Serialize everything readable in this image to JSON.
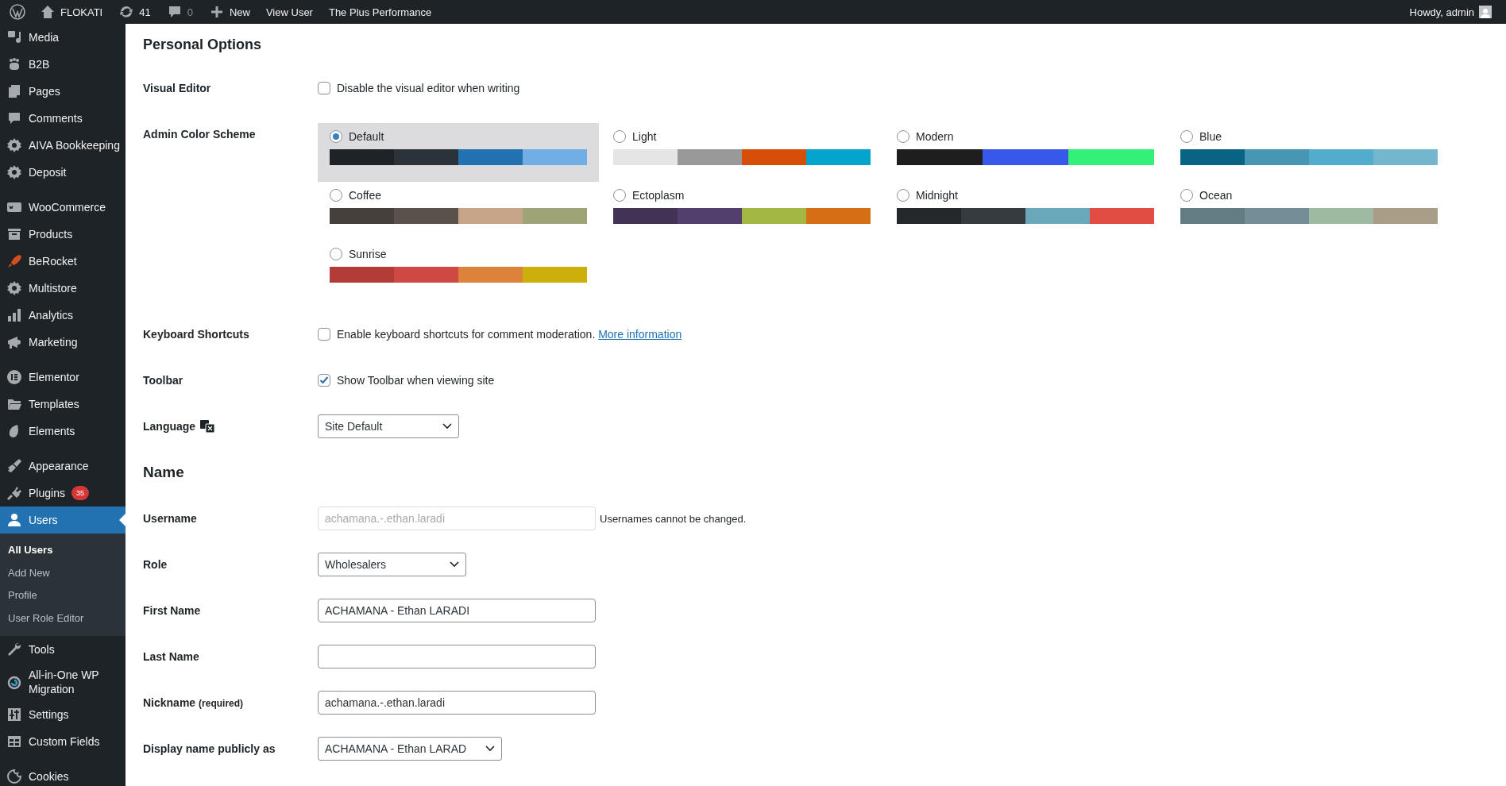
{
  "admin_bar": {
    "site_name": "FLOKATI",
    "updates_count": "41",
    "comments_count": "0",
    "new_label": "New",
    "links": [
      "View User",
      "The Plus Performance"
    ],
    "greeting": "Howdy, admin"
  },
  "sidebar": {
    "groups": [
      [
        {
          "label": "Media",
          "selected": false
        },
        {
          "label": "B2B",
          "selected": false
        },
        {
          "label": "Pages",
          "selected": false
        },
        {
          "label": "Comments",
          "selected": false
        },
        {
          "label": "AIVA Bookkeeping",
          "selected": false
        },
        {
          "label": "Deposit",
          "selected": false
        }
      ],
      [
        {
          "label": "WooCommerce",
          "selected": false
        },
        {
          "label": "Products",
          "selected": false
        },
        {
          "label": "BeRocket",
          "selected": false
        },
        {
          "label": "Multistore",
          "selected": false
        },
        {
          "label": "Analytics",
          "selected": false
        },
        {
          "label": "Marketing",
          "selected": false
        }
      ],
      [
        {
          "label": "Elementor",
          "selected": false
        },
        {
          "label": "Templates",
          "selected": false
        },
        {
          "label": "Elements",
          "selected": false
        }
      ],
      [
        {
          "label": "Appearance",
          "selected": false
        },
        {
          "label": "Plugins",
          "selected": false,
          "badge": "35"
        },
        {
          "label": "Users",
          "selected": true,
          "submenu": [
            {
              "label": "All Users",
              "selected": true
            },
            {
              "label": "Add New",
              "selected": false
            },
            {
              "label": "Profile",
              "selected": false
            },
            {
              "label": "User Role Editor",
              "selected": false
            }
          ]
        },
        {
          "label": "Tools",
          "selected": false
        },
        {
          "label": "All-in-One WP Migration",
          "selected": false
        },
        {
          "label": "Settings",
          "selected": false
        },
        {
          "label": "Custom Fields",
          "selected": false
        }
      ],
      [
        {
          "label": "Cookies",
          "selected": false
        }
      ]
    ]
  },
  "personal_options": {
    "heading": "Personal Options",
    "visual_editor": {
      "label": "Visual Editor",
      "checkbox_label": "Disable the visual editor when writing",
      "checked": false
    },
    "color_scheme": {
      "label": "Admin Color Scheme",
      "schemes": [
        {
          "name": "Default",
          "selected": true,
          "swatches": [
            {
              "color": "#1d2327"
            },
            {
              "color": "#2c3338"
            },
            {
              "color": "#2271b1"
            },
            {
              "color": "#72aee6"
            }
          ]
        },
        {
          "name": "Light",
          "selected": false,
          "swatches": [
            {
              "color": "#e5e5e5"
            },
            {
              "color": "#999999"
            },
            {
              "color": "#d64e07"
            },
            {
              "color": "#04a4cc"
            }
          ]
        },
        {
          "name": "Modern",
          "selected": false,
          "swatches": [
            {
              "color": "#1e1e1e"
            },
            {
              "color": "#3858e9"
            },
            {
              "color": "#33f078"
            }
          ]
        },
        {
          "name": "Blue",
          "selected": false,
          "swatches": [
            {
              "color": "#096484"
            },
            {
              "color": "#4796b3"
            },
            {
              "color": "#52accc"
            },
            {
              "color": "#74b6ce"
            }
          ]
        },
        {
          "name": "Coffee",
          "selected": false,
          "swatches": [
            {
              "color": "#46403c"
            },
            {
              "color": "#59524c"
            },
            {
              "color": "#c7a589"
            },
            {
              "color": "#9ea476"
            }
          ]
        },
        {
          "name": "Ectoplasm",
          "selected": false,
          "swatches": [
            {
              "color": "#413256"
            },
            {
              "color": "#523f6d"
            },
            {
              "color": "#a3b745"
            },
            {
              "color": "#d46f15"
            }
          ]
        },
        {
          "name": "Midnight",
          "selected": false,
          "swatches": [
            {
              "color": "#25282b"
            },
            {
              "color": "#363b3f"
            },
            {
              "color": "#69a8bb"
            },
            {
              "color": "#e14d43"
            }
          ]
        },
        {
          "name": "Ocean",
          "selected": false,
          "swatches": [
            {
              "color": "#627c83"
            },
            {
              "color": "#738e96"
            },
            {
              "color": "#9ebaa0"
            },
            {
              "color": "#aa9d88"
            }
          ]
        },
        {
          "name": "Sunrise",
          "selected": false,
          "swatches": [
            {
              "color": "#b43c38"
            },
            {
              "color": "#cf4944"
            },
            {
              "color": "#dd823b"
            },
            {
              "color": "#ccaf0b"
            }
          ]
        }
      ]
    },
    "keyboard_shortcuts": {
      "label": "Keyboard Shortcuts",
      "checkbox_label": "Enable keyboard shortcuts for comment moderation.",
      "link": "More information",
      "checked": false
    },
    "toolbar": {
      "label": "Toolbar",
      "checkbox_label": "Show Toolbar when viewing site",
      "checked": true
    },
    "language": {
      "label": "Language",
      "value": "Site Default"
    }
  },
  "name_section": {
    "heading": "Name",
    "fields": [
      {
        "kind": "text",
        "label": "Username",
        "value": "achamana.-.ethan.laradi",
        "disabled": true,
        "note": "Usernames cannot be changed."
      },
      {
        "kind": "select",
        "label": "Role",
        "value": "Wholesalers"
      },
      {
        "kind": "text",
        "label": "First Name",
        "value": "ACHAMANA - Ethan LARADI"
      },
      {
        "kind": "text",
        "label": "Last Name"
      },
      {
        "kind": "text",
        "label": "Nickname",
        "label_note": "(required)",
        "value": "achamana.-.ethan.laradi"
      },
      {
        "kind": "select",
        "label": "Display name publicly as",
        "value": "ACHAMANA - Ethan LARAD"
      }
    ]
  }
}
